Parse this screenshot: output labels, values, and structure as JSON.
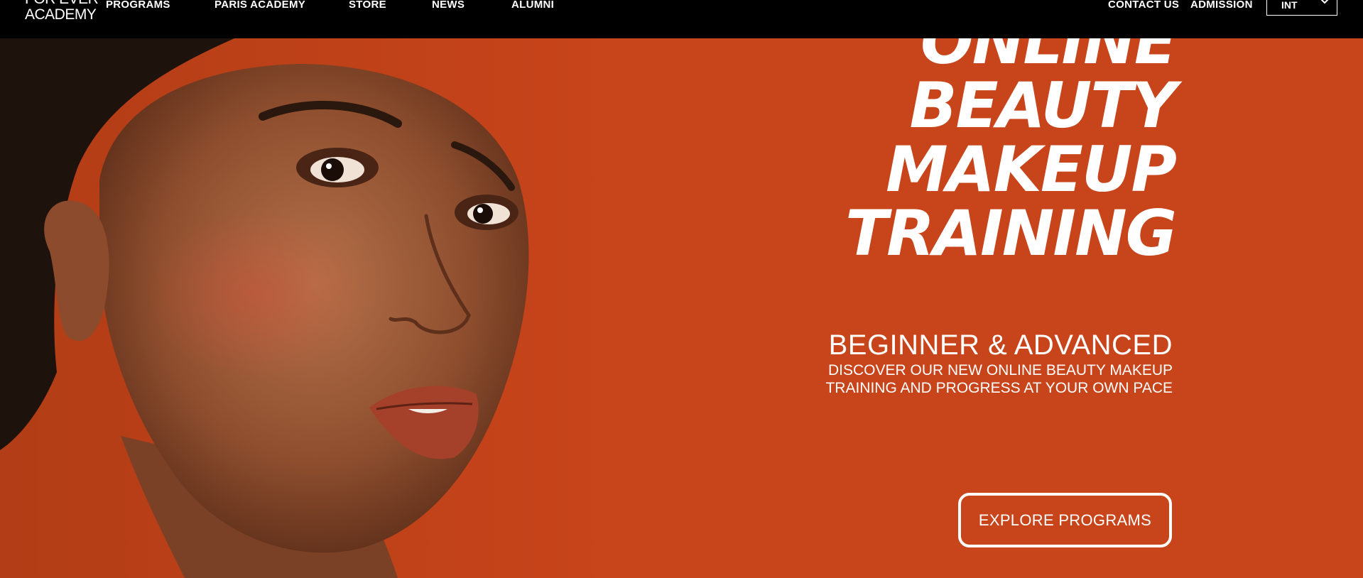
{
  "header": {
    "logo_line1": "FOR EVER",
    "logo_line2": "ACADEMY",
    "nav": [
      "PROGRAMS",
      "PARIS ACADEMY",
      "STORE",
      "NEWS",
      "ALUMNI"
    ],
    "contact_label": "CONTACT US",
    "admission_label": "ADMISSION",
    "language": "INT"
  },
  "hero": {
    "headline": [
      "ONLINE",
      "BEAUTY",
      "MAKEUP",
      "TRAINING"
    ],
    "subtitle": "BEGINNER & ADVANCED",
    "description": [
      "DISCOVER OUR NEW ONLINE BEAUTY MAKEUP",
      "TRAINING AND PROGRESS AT YOUR OWN PACE"
    ],
    "cta_label": "EXPLORE PROGRAMS"
  },
  "colors": {
    "background": "#c8441a",
    "nav_bg": "#000000",
    "text": "#ffffff"
  },
  "icons": {
    "language_dropdown": "chevron-down-icon"
  }
}
